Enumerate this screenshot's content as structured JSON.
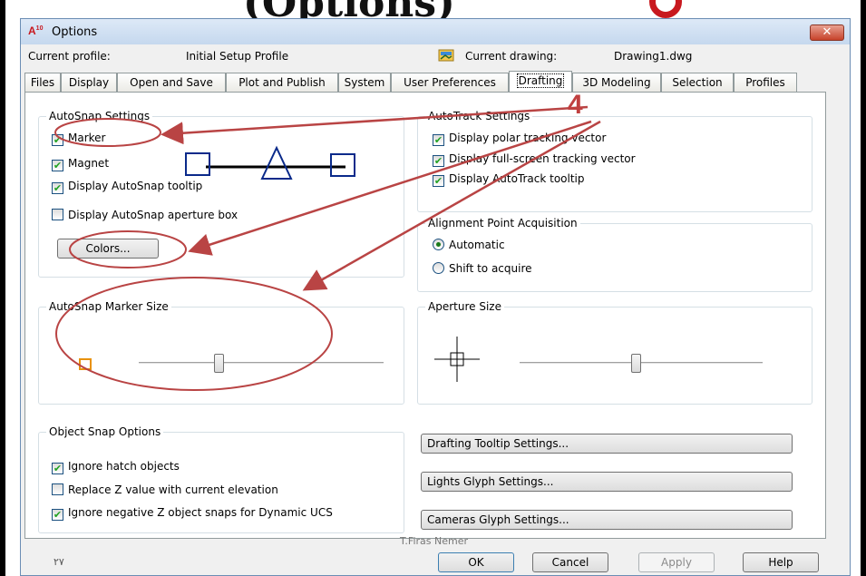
{
  "slide": {
    "title": "(Options)"
  },
  "window": {
    "title": "Options",
    "app_badge": "A",
    "app_badge_sup": "10",
    "close_glyph": "✕"
  },
  "profile": {
    "current_profile_label": "Current profile:",
    "current_profile_value": "Initial Setup Profile",
    "current_drawing_label": "Current drawing:",
    "current_drawing_value": "Drawing1.dwg"
  },
  "tabs": [
    {
      "label": "Files"
    },
    {
      "label": "Display"
    },
    {
      "label": "Open and Save"
    },
    {
      "label": "Plot and Publish"
    },
    {
      "label": "System"
    },
    {
      "label": "User Preferences"
    },
    {
      "label": "Drafting"
    },
    {
      "label": "3D Modeling"
    },
    {
      "label": "Selection"
    },
    {
      "label": "Profiles"
    }
  ],
  "active_tab": "Drafting",
  "autosnap": {
    "title": "AutoSnap Settings",
    "marker": {
      "label": "Marker",
      "checked": true
    },
    "magnet": {
      "label": "Magnet",
      "checked": true
    },
    "tooltip": {
      "label": "Display AutoSnap tooltip",
      "checked": true
    },
    "aperture_box": {
      "label": "Display AutoSnap aperture box",
      "checked": false
    },
    "colors_button": "Colors..."
  },
  "autotrack": {
    "title": "AutoTrack Settings",
    "polar": {
      "label": "Display polar tracking vector",
      "checked": true
    },
    "fullscreen": {
      "label": "Display full-screen tracking vector",
      "checked": true
    },
    "tooltip": {
      "label": "Display AutoTrack tooltip",
      "checked": true
    }
  },
  "alignment": {
    "title": "Alignment Point Acquisition",
    "automatic": {
      "label": "Automatic",
      "selected": true
    },
    "shift": {
      "label": "Shift to acquire",
      "selected": false
    }
  },
  "marker_size": {
    "title": "AutoSnap Marker Size",
    "value": 0.33,
    "marker_color": "#e8920c"
  },
  "aperture_size": {
    "title": "Aperture Size",
    "value": 0.48
  },
  "object_snap": {
    "title": "Object Snap Options",
    "ignore_hatch": {
      "label": "Ignore hatch objects",
      "checked": true
    },
    "replace_z": {
      "label": "Replace Z value with current elevation",
      "checked": false
    },
    "ignore_negative_z": {
      "label": "Ignore negative Z object snaps for Dynamic UCS",
      "checked": true
    }
  },
  "settings_buttons": {
    "drafting_tooltip": "Drafting Tooltip Settings...",
    "lights_glyph": "Lights Glyph Settings...",
    "cameras_glyph": "Cameras Glyph Settings..."
  },
  "footer": {
    "page_number": "٢٧",
    "author": "T.Firas Nemer",
    "ok": "OK",
    "cancel": "Cancel",
    "apply": "Apply",
    "help": "Help"
  },
  "annotation": {
    "step_number": "4",
    "color": "#b94444"
  },
  "check_glyph": "✔"
}
